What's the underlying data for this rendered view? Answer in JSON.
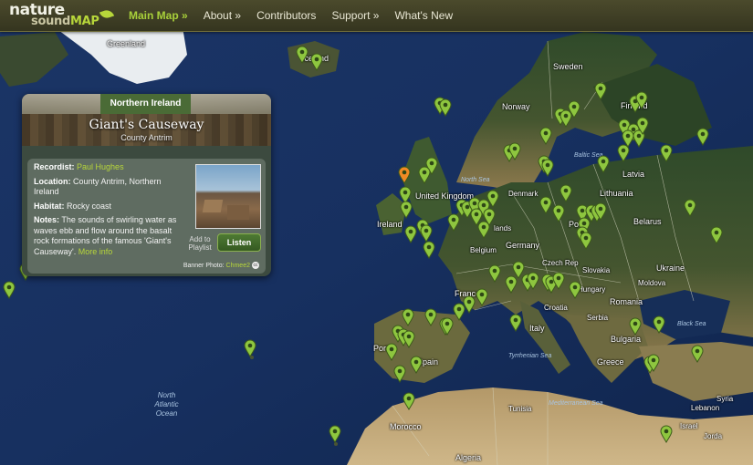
{
  "logo": {
    "word1": "nature",
    "word2a": "sound",
    "word2b": "MAP"
  },
  "nav": [
    {
      "label": "Main Map »",
      "active": true
    },
    {
      "label": "About »",
      "active": false
    },
    {
      "label": "Contributors",
      "active": false
    },
    {
      "label": "Support »",
      "active": false
    },
    {
      "label": "What's New",
      "active": false
    }
  ],
  "card": {
    "region": "Northern Ireland",
    "title": "Giant's Causeway",
    "subtitle": "County Antrim",
    "recordist_label": "Recordist:",
    "recordist": "Paul Hughes",
    "location_label": "Location:",
    "location": "County Antrim, Northern Ireland",
    "habitat_label": "Habitat:",
    "habitat": "Rocky coast",
    "notes_label": "Notes:",
    "notes": "The sounds of swirling water as waves ebb and flow around the basalt rock formations of the famous 'Giant's Causeway'.",
    "more_info": "More info",
    "add_playlist": "Add to Playlist",
    "listen": "Listen",
    "banner_photo_label": "Banner Photo:",
    "banner_photo_credit": "Chmee2",
    "cc": "cc"
  },
  "map_labels": {
    "greenland": "Greenland",
    "iceland": "Iceland",
    "sweden": "Sweden",
    "norway": "Norway",
    "finland": "Finland",
    "baltic_sea": "Baltic Sea",
    "latvia": "Latvia",
    "lithuania": "Lithuania",
    "denmark": "Denmark",
    "north_sea": "North Sea",
    "united_kingdom": "United Kingdom",
    "ireland": "Ireland",
    "netherlands": "lands",
    "poland": "Po",
    "belarus": "Belarus",
    "belgium": "Belgium",
    "germany": "Germany",
    "czech_rep": "Czech Rep",
    "slovakia": "Slovakia",
    "ukraine": "Ukraine",
    "france": "France",
    "hungary": "Hungary",
    "moldova": "Moldova",
    "romania": "Romania",
    "croatia": "Croatia",
    "serbia": "Serbia",
    "black_sea": "Black Sea",
    "bulgaria": "Bulgaria",
    "italy": "Italy",
    "portugal": "Port",
    "spain": "Spain",
    "tyrrhenian_sea": "Tyrrhenian Sea",
    "greece": "Greece",
    "tunisia": "Tunisia",
    "mediterranean_sea": "Mediterranean Sea",
    "lebanon": "Lebanon",
    "israel": "Israel",
    "jordan": "Jorda",
    "syria": "Syria",
    "morocco": "Morocco",
    "algeria": "Algeria",
    "north_atlantic_1": "North",
    "north_atlantic_2": "Atlantic",
    "north_atlantic_3": "Ocean"
  },
  "pins": {
    "count_note": "",
    "selected_color": "#f08a24",
    "default_color": "#8ec63f"
  }
}
